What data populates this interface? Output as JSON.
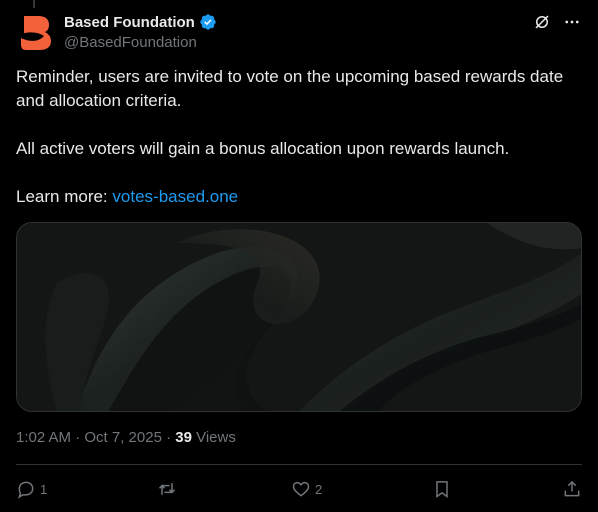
{
  "account": {
    "display_name": "Based Foundation",
    "handle": "@BasedFoundation"
  },
  "post": {
    "line1": "Reminder, users are invited to vote on the upcoming based rewards date and allocation criteria.",
    "line2": "All active voters will gain a bonus allocation upon rewards launch.",
    "learn_more_label": "Learn more:",
    "link_text": "votes-based.one"
  },
  "meta": {
    "timestamp": "1:02 AM · Oct 7, 2025 · ",
    "views_count": "39",
    "views_label": " Views"
  },
  "actions": {
    "reply_count": "1",
    "repost_count": "",
    "like_count": "2"
  },
  "colors": {
    "accent": "#1d9bf0",
    "brand": "#f2613a"
  },
  "icons": [
    "verified-badge-icon",
    "grok-icon",
    "more-icon",
    "reply-icon",
    "repost-icon",
    "like-icon",
    "bookmark-icon",
    "share-icon"
  ]
}
